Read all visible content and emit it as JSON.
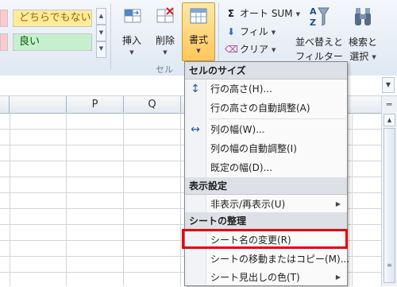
{
  "styles": {
    "neutral": "どちらでもない",
    "good": "良い"
  },
  "cells_group": {
    "label": "セル",
    "insert": "挿入",
    "delete": "削除",
    "format": "書式"
  },
  "editing": {
    "autosum": "オート SUM",
    "fill": "フィル",
    "clear": "クリア",
    "sort_line1": "並べ替えと",
    "sort_line2": "フィルター",
    "find_line1": "検索と",
    "find_line2": "選択"
  },
  "columns": [
    "P",
    "Q",
    "R"
  ],
  "menu": {
    "section_cell_size": "セルのサイズ",
    "row_height": "行の高さ(H)...",
    "autofit_row": "行の高さの自動調整(A)",
    "col_width": "列の幅(W)...",
    "autofit_col": "列の幅の自動調整(I)",
    "default_width": "既定の幅(D)...",
    "section_visibility": "表示設定",
    "hide_unhide": "非表示/再表示(U)",
    "section_organize": "シートの整理",
    "rename_sheet": "シート名の変更(R)",
    "move_copy": "シートの移動またはコピー(M)...",
    "tab_color": "シート見出しの色(T)"
  },
  "colors": {
    "highlight": "#e8000b",
    "neutral_fill": "#ffeb9c",
    "good_fill": "#c6efce"
  }
}
